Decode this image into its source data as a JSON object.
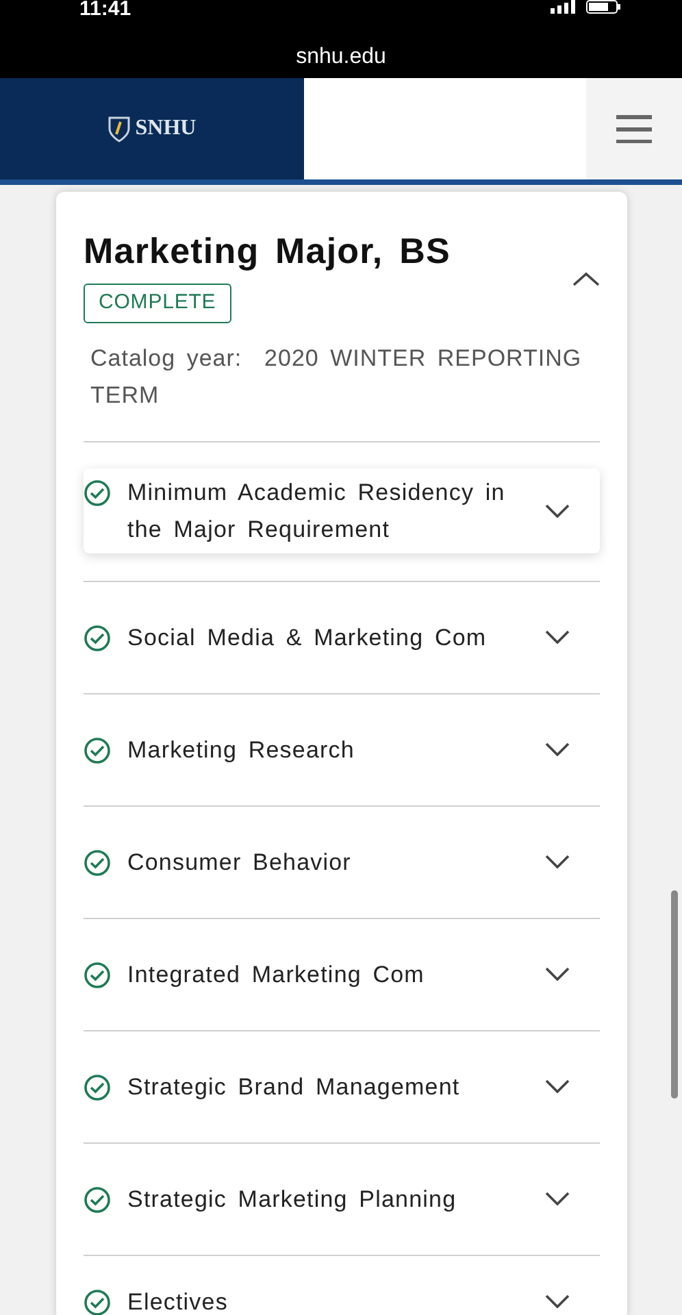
{
  "status_bar": {
    "time": "11:41"
  },
  "browser": {
    "url": "snhu.edu"
  },
  "header": {
    "logo_text": "SNHU"
  },
  "program": {
    "title": "Marketing Major, BS",
    "expanded": true,
    "status": "COMPLETE",
    "catalog_label": "Catalog year:",
    "catalog_value": "2020 WINTER REPORTING TERM"
  },
  "requirements": [
    {
      "label": "Minimum Academic Residency in the Major Requirement",
      "complete": true,
      "expanded": false,
      "selected": true
    },
    {
      "label": "Social Media & Marketing Com",
      "complete": true,
      "expanded": false,
      "selected": false
    },
    {
      "label": "Marketing Research",
      "complete": true,
      "expanded": false,
      "selected": false
    },
    {
      "label": "Consumer Behavior",
      "complete": true,
      "expanded": false,
      "selected": false
    },
    {
      "label": "Integrated Marketing Com",
      "complete": true,
      "expanded": false,
      "selected": false
    },
    {
      "label": "Strategic Brand Management",
      "complete": true,
      "expanded": false,
      "selected": false
    },
    {
      "label": "Strategic Marketing Planning",
      "complete": true,
      "expanded": false,
      "selected": false
    },
    {
      "label": "Electives",
      "complete": true,
      "expanded": false,
      "selected": false
    }
  ]
}
